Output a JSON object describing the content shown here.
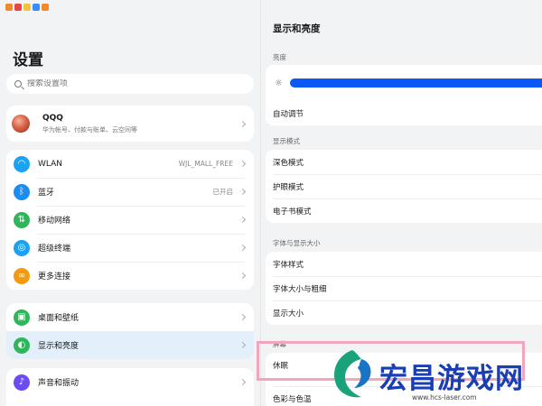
{
  "left": {
    "title": "设置",
    "search_placeholder": "搜索设置项",
    "account": {
      "name": "QQQ",
      "subtitle": "华为帐号、付款与账单、云空间等"
    },
    "group1": [
      {
        "label": "WLAN",
        "value": "WJL_MALL_FREE",
        "icon": "wifi-icon",
        "color": "#1aa3f2"
      },
      {
        "label": "蓝牙",
        "value": "已开启",
        "icon": "bluetooth-icon",
        "color": "#1a8cf2"
      },
      {
        "label": "移动网络",
        "value": "",
        "icon": "signal-icon",
        "color": "#2fb55a"
      },
      {
        "label": "超级终端",
        "value": "",
        "icon": "super-device-icon",
        "color": "#1aa3f2"
      },
      {
        "label": "更多连接",
        "value": "",
        "icon": "link-icon",
        "color": "#f29a12"
      }
    ],
    "group2": [
      {
        "label": "桌面和壁纸",
        "icon": "wallpaper-icon",
        "color": "#2fb55a"
      },
      {
        "label": "显示和亮度",
        "icon": "display-icon",
        "color": "#2fb55a"
      }
    ],
    "group3": [
      {
        "label": "声音和振动",
        "icon": "sound-icon",
        "color": "#6b4cf2"
      }
    ]
  },
  "right": {
    "title": "显示和亮度",
    "brightness_section": "亮度",
    "auto_adjust": "自动调节",
    "brightness_level": 1.0,
    "display_mode_section": "显示模式",
    "display_modes": [
      "深色模式",
      "护眼模式",
      "电子书模式"
    ],
    "font_section": "字体与显示大小",
    "font_items": [
      "字体样式",
      "字体大小与粗细",
      "显示大小"
    ],
    "screen_section": "屏幕",
    "screen_items": [
      "休眠",
      "色彩与色温"
    ]
  },
  "watermark": {
    "text": "宏昌游戏网",
    "url": "www.hcs-laser.com"
  },
  "colors": {
    "accent": "#0a59f7",
    "selected_bg": "#e3f0fc",
    "highlight": "#f1a6bd"
  }
}
